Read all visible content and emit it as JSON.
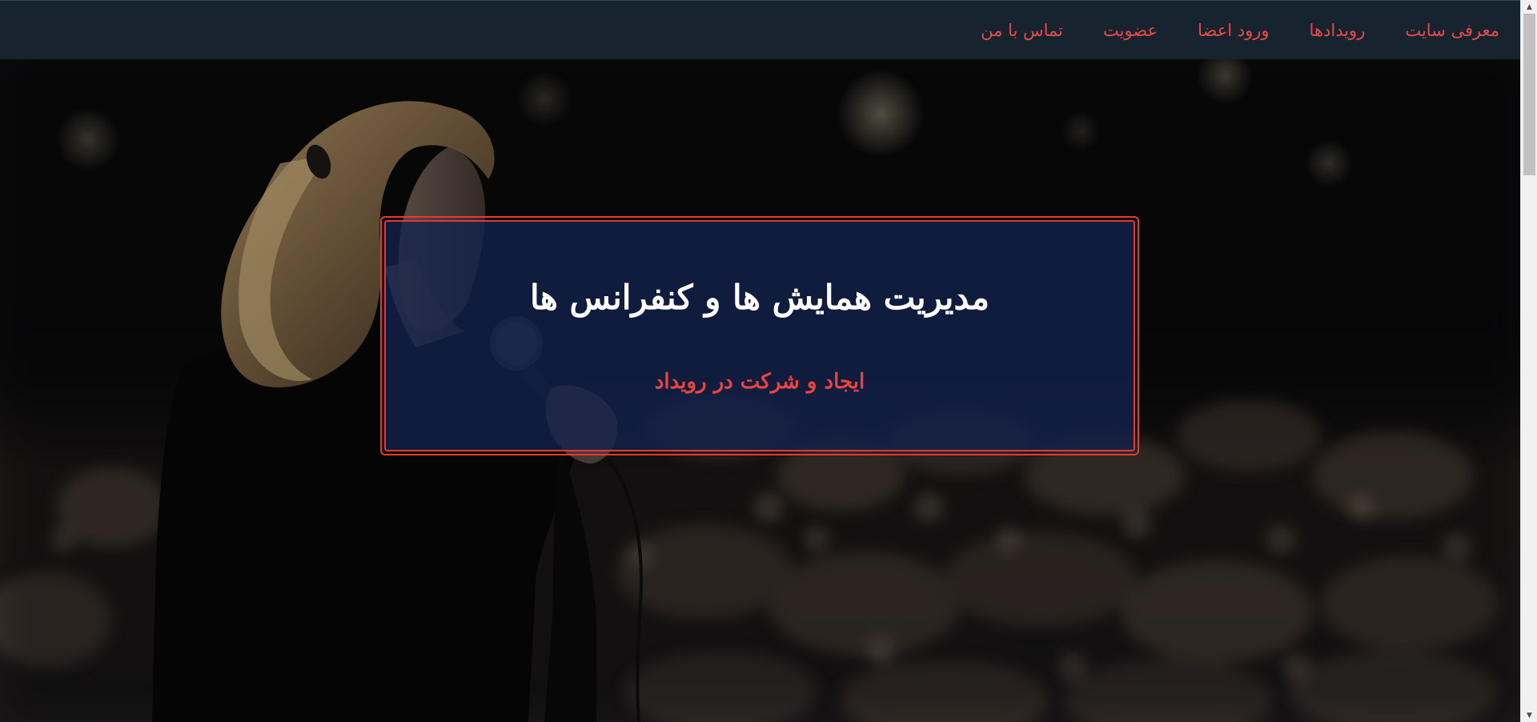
{
  "nav": {
    "items": [
      {
        "label": "معرفی سایت"
      },
      {
        "label": "رویدادها"
      },
      {
        "label": "ورود اعضا"
      },
      {
        "label": "عضویت"
      },
      {
        "label": "تماس با من"
      }
    ]
  },
  "hero": {
    "title": "مدیریت همایش ها و کنفرانس ها",
    "subtitle": "ایجاد و شرکت در رویداد"
  },
  "colors": {
    "navbar_bg": "#172430",
    "nav_link": "#e84a46",
    "box_border": "#e53935",
    "box_bg": "#13224e",
    "title": "#ffffff",
    "subtitle": "#e8453f"
  },
  "scrollbar": {
    "up_icon": "triangle-up",
    "down_icon": "triangle-down"
  }
}
